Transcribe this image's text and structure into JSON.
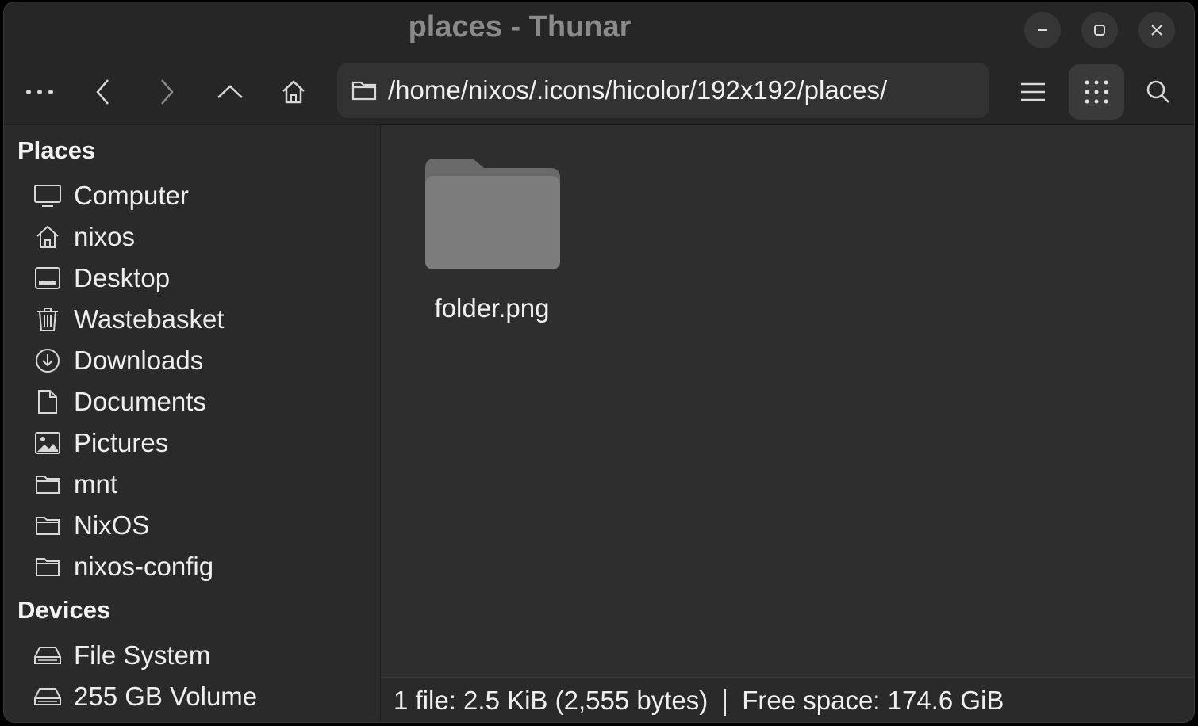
{
  "window": {
    "title": "places - Thunar"
  },
  "titlebar_buttons": [
    "minimize-icon",
    "maximize-icon",
    "close-icon"
  ],
  "toolbar": {
    "menu_icon": "more-horizontal-icon",
    "back_icon": "chevron-left-icon",
    "forward_icon": "chevron-right-icon",
    "up_icon": "chevron-up-icon",
    "home_icon": "home-icon",
    "view_list_icon": "list-view-icon",
    "view_grid_icon": "grid-view-icon",
    "search_icon": "search-icon"
  },
  "location": {
    "path": "/home/nixos/.icons/hicolor/192x192/places/",
    "icon": "folder-icon"
  },
  "sidebar": {
    "places_heading": "Places",
    "places": [
      {
        "label": "Computer",
        "icon": "monitor-icon"
      },
      {
        "label": "nixos",
        "icon": "home-icon"
      },
      {
        "label": "Desktop",
        "icon": "desktop-icon"
      },
      {
        "label": "Wastebasket",
        "icon": "trash-icon"
      },
      {
        "label": "Downloads",
        "icon": "download-icon"
      },
      {
        "label": "Documents",
        "icon": "document-icon"
      },
      {
        "label": "Pictures",
        "icon": "image-icon"
      },
      {
        "label": "mnt",
        "icon": "folder-icon"
      },
      {
        "label": "NixOS",
        "icon": "folder-icon"
      },
      {
        "label": "nixos-config",
        "icon": "folder-icon"
      }
    ],
    "devices_heading": "Devices",
    "devices": [
      {
        "label": "File System",
        "icon": "drive-icon"
      },
      {
        "label": "255 GB Volume",
        "icon": "drive-icon"
      }
    ]
  },
  "files": [
    {
      "name": "folder.png",
      "icon": "folder-icon"
    }
  ],
  "status": {
    "selection": "1 file: 2.5 KiB (2,555 bytes)",
    "free_space": "Free space: 174.6 GiB"
  },
  "colors": {
    "titlebar_bg": "#262626",
    "sidebar_bg": "#2a2a2a",
    "main_bg": "#2e2e2e",
    "text": "#eeeeee",
    "folder_icon": "#7a7a7a"
  }
}
